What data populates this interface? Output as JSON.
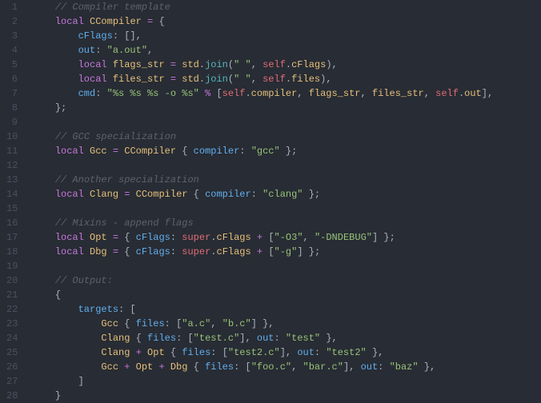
{
  "lines": [
    {
      "num": 1,
      "tokens": [
        [
          "sp",
          "    "
        ],
        [
          "comment",
          "// Compiler template"
        ]
      ]
    },
    {
      "num": 2,
      "tokens": [
        [
          "sp",
          "    "
        ],
        [
          "keyword",
          "local"
        ],
        [
          "sp",
          " "
        ],
        [
          "ident",
          "CCompiler"
        ],
        [
          "sp",
          " "
        ],
        [
          "op",
          "="
        ],
        [
          "sp",
          " "
        ],
        [
          "punc",
          "{"
        ]
      ]
    },
    {
      "num": 3,
      "tokens": [
        [
          "sp",
          "        "
        ],
        [
          "prop",
          "cFlags"
        ],
        [
          "punc",
          ":"
        ],
        [
          "sp",
          " "
        ],
        [
          "punc",
          "[],"
        ]
      ]
    },
    {
      "num": 4,
      "tokens": [
        [
          "sp",
          "        "
        ],
        [
          "prop",
          "out"
        ],
        [
          "punc",
          ":"
        ],
        [
          "sp",
          " "
        ],
        [
          "string",
          "\"a.out\""
        ],
        [
          "punc",
          ","
        ]
      ]
    },
    {
      "num": 5,
      "tokens": [
        [
          "sp",
          "        "
        ],
        [
          "keyword",
          "local"
        ],
        [
          "sp",
          " "
        ],
        [
          "ident",
          "flags_str"
        ],
        [
          "sp",
          " "
        ],
        [
          "op",
          "="
        ],
        [
          "sp",
          " "
        ],
        [
          "ident",
          "std"
        ],
        [
          "punc",
          "."
        ],
        [
          "func",
          "join"
        ],
        [
          "punc",
          "("
        ],
        [
          "string",
          "\" \""
        ],
        [
          "punc",
          ", "
        ],
        [
          "self",
          "self"
        ],
        [
          "punc",
          "."
        ],
        [
          "ident",
          "cFlags"
        ],
        [
          "punc",
          "),"
        ]
      ]
    },
    {
      "num": 6,
      "tokens": [
        [
          "sp",
          "        "
        ],
        [
          "keyword",
          "local"
        ],
        [
          "sp",
          " "
        ],
        [
          "ident",
          "files_str"
        ],
        [
          "sp",
          " "
        ],
        [
          "op",
          "="
        ],
        [
          "sp",
          " "
        ],
        [
          "ident",
          "std"
        ],
        [
          "punc",
          "."
        ],
        [
          "func",
          "join"
        ],
        [
          "punc",
          "("
        ],
        [
          "string",
          "\" \""
        ],
        [
          "punc",
          ", "
        ],
        [
          "self",
          "self"
        ],
        [
          "punc",
          "."
        ],
        [
          "ident",
          "files"
        ],
        [
          "punc",
          "),"
        ]
      ]
    },
    {
      "num": 7,
      "tokens": [
        [
          "sp",
          "        "
        ],
        [
          "prop",
          "cmd"
        ],
        [
          "punc",
          ":"
        ],
        [
          "sp",
          " "
        ],
        [
          "string",
          "\"%s %s %s -o %s\""
        ],
        [
          "sp",
          " "
        ],
        [
          "op",
          "%"
        ],
        [
          "sp",
          " "
        ],
        [
          "punc",
          "["
        ],
        [
          "self",
          "self"
        ],
        [
          "punc",
          "."
        ],
        [
          "ident",
          "compiler"
        ],
        [
          "punc",
          ", "
        ],
        [
          "ident",
          "flags_str"
        ],
        [
          "punc",
          ", "
        ],
        [
          "ident",
          "files_str"
        ],
        [
          "punc",
          ", "
        ],
        [
          "self",
          "self"
        ],
        [
          "punc",
          "."
        ],
        [
          "ident",
          "out"
        ],
        [
          "punc",
          "],"
        ]
      ]
    },
    {
      "num": 8,
      "tokens": [
        [
          "sp",
          "    "
        ],
        [
          "punc",
          "};"
        ]
      ]
    },
    {
      "num": 9,
      "tokens": [
        [
          "sp",
          ""
        ]
      ]
    },
    {
      "num": 10,
      "tokens": [
        [
          "sp",
          "    "
        ],
        [
          "comment",
          "// GCC specialization"
        ]
      ]
    },
    {
      "num": 11,
      "tokens": [
        [
          "sp",
          "    "
        ],
        [
          "keyword",
          "local"
        ],
        [
          "sp",
          " "
        ],
        [
          "ident",
          "Gcc"
        ],
        [
          "sp",
          " "
        ],
        [
          "op",
          "="
        ],
        [
          "sp",
          " "
        ],
        [
          "ident",
          "CCompiler"
        ],
        [
          "sp",
          " "
        ],
        [
          "punc",
          "{"
        ],
        [
          "sp",
          " "
        ],
        [
          "prop",
          "compiler"
        ],
        [
          "punc",
          ":"
        ],
        [
          "sp",
          " "
        ],
        [
          "string",
          "\"gcc\""
        ],
        [
          "sp",
          " "
        ],
        [
          "punc",
          "};"
        ]
      ]
    },
    {
      "num": 12,
      "tokens": [
        [
          "sp",
          ""
        ]
      ]
    },
    {
      "num": 13,
      "tokens": [
        [
          "sp",
          "    "
        ],
        [
          "comment",
          "// Another specialization"
        ]
      ]
    },
    {
      "num": 14,
      "tokens": [
        [
          "sp",
          "    "
        ],
        [
          "keyword",
          "local"
        ],
        [
          "sp",
          " "
        ],
        [
          "ident",
          "Clang"
        ],
        [
          "sp",
          " "
        ],
        [
          "op",
          "="
        ],
        [
          "sp",
          " "
        ],
        [
          "ident",
          "CCompiler"
        ],
        [
          "sp",
          " "
        ],
        [
          "punc",
          "{"
        ],
        [
          "sp",
          " "
        ],
        [
          "prop",
          "compiler"
        ],
        [
          "punc",
          ":"
        ],
        [
          "sp",
          " "
        ],
        [
          "string",
          "\"clang\""
        ],
        [
          "sp",
          " "
        ],
        [
          "punc",
          "};"
        ]
      ]
    },
    {
      "num": 15,
      "tokens": [
        [
          "sp",
          ""
        ]
      ]
    },
    {
      "num": 16,
      "tokens": [
        [
          "sp",
          "    "
        ],
        [
          "comment",
          "// Mixins - append flags"
        ]
      ]
    },
    {
      "num": 17,
      "tokens": [
        [
          "sp",
          "    "
        ],
        [
          "keyword",
          "local"
        ],
        [
          "sp",
          " "
        ],
        [
          "ident",
          "Opt"
        ],
        [
          "sp",
          " "
        ],
        [
          "op",
          "="
        ],
        [
          "sp",
          " "
        ],
        [
          "punc",
          "{"
        ],
        [
          "sp",
          " "
        ],
        [
          "prop",
          "cFlags"
        ],
        [
          "punc",
          ":"
        ],
        [
          "sp",
          " "
        ],
        [
          "self",
          "super"
        ],
        [
          "punc",
          "."
        ],
        [
          "ident",
          "cFlags"
        ],
        [
          "sp",
          " "
        ],
        [
          "op",
          "+"
        ],
        [
          "sp",
          " "
        ],
        [
          "punc",
          "["
        ],
        [
          "string",
          "\"-O3\""
        ],
        [
          "punc",
          ", "
        ],
        [
          "string",
          "\"-DNDEBUG\""
        ],
        [
          "punc",
          "]"
        ],
        [
          "sp",
          " "
        ],
        [
          "punc",
          "};"
        ]
      ]
    },
    {
      "num": 18,
      "tokens": [
        [
          "sp",
          "    "
        ],
        [
          "keyword",
          "local"
        ],
        [
          "sp",
          " "
        ],
        [
          "ident",
          "Dbg"
        ],
        [
          "sp",
          " "
        ],
        [
          "op",
          "="
        ],
        [
          "sp",
          " "
        ],
        [
          "punc",
          "{"
        ],
        [
          "sp",
          " "
        ],
        [
          "prop",
          "cFlags"
        ],
        [
          "punc",
          ":"
        ],
        [
          "sp",
          " "
        ],
        [
          "self",
          "super"
        ],
        [
          "punc",
          "."
        ],
        [
          "ident",
          "cFlags"
        ],
        [
          "sp",
          " "
        ],
        [
          "op",
          "+"
        ],
        [
          "sp",
          " "
        ],
        [
          "punc",
          "["
        ],
        [
          "string",
          "\"-g\""
        ],
        [
          "punc",
          "]"
        ],
        [
          "sp",
          " "
        ],
        [
          "punc",
          "};"
        ]
      ]
    },
    {
      "num": 19,
      "tokens": [
        [
          "sp",
          ""
        ]
      ]
    },
    {
      "num": 20,
      "tokens": [
        [
          "sp",
          "    "
        ],
        [
          "comment",
          "// Output:"
        ]
      ]
    },
    {
      "num": 21,
      "tokens": [
        [
          "sp",
          "    "
        ],
        [
          "punc",
          "{"
        ]
      ]
    },
    {
      "num": 22,
      "tokens": [
        [
          "sp",
          "        "
        ],
        [
          "prop",
          "targets"
        ],
        [
          "punc",
          ":"
        ],
        [
          "sp",
          " "
        ],
        [
          "punc",
          "["
        ]
      ]
    },
    {
      "num": 23,
      "tokens": [
        [
          "sp",
          "            "
        ],
        [
          "ident",
          "Gcc"
        ],
        [
          "sp",
          " "
        ],
        [
          "punc",
          "{"
        ],
        [
          "sp",
          " "
        ],
        [
          "prop",
          "files"
        ],
        [
          "punc",
          ":"
        ],
        [
          "sp",
          " "
        ],
        [
          "punc",
          "["
        ],
        [
          "string",
          "\"a.c\""
        ],
        [
          "punc",
          ", "
        ],
        [
          "string",
          "\"b.c\""
        ],
        [
          "punc",
          "]"
        ],
        [
          "sp",
          " "
        ],
        [
          "punc",
          "},"
        ]
      ]
    },
    {
      "num": 24,
      "tokens": [
        [
          "sp",
          "            "
        ],
        [
          "ident",
          "Clang"
        ],
        [
          "sp",
          " "
        ],
        [
          "punc",
          "{"
        ],
        [
          "sp",
          " "
        ],
        [
          "prop",
          "files"
        ],
        [
          "punc",
          ":"
        ],
        [
          "sp",
          " "
        ],
        [
          "punc",
          "["
        ],
        [
          "string",
          "\"test.c\""
        ],
        [
          "punc",
          "]"
        ],
        [
          "punc",
          ", "
        ],
        [
          "prop",
          "out"
        ],
        [
          "punc",
          ":"
        ],
        [
          "sp",
          " "
        ],
        [
          "string",
          "\"test\""
        ],
        [
          "sp",
          " "
        ],
        [
          "punc",
          "},"
        ]
      ]
    },
    {
      "num": 25,
      "tokens": [
        [
          "sp",
          "            "
        ],
        [
          "ident",
          "Clang"
        ],
        [
          "sp",
          " "
        ],
        [
          "op",
          "+"
        ],
        [
          "sp",
          " "
        ],
        [
          "ident",
          "Opt"
        ],
        [
          "sp",
          " "
        ],
        [
          "punc",
          "{"
        ],
        [
          "sp",
          " "
        ],
        [
          "prop",
          "files"
        ],
        [
          "punc",
          ":"
        ],
        [
          "sp",
          " "
        ],
        [
          "punc",
          "["
        ],
        [
          "string",
          "\"test2.c\""
        ],
        [
          "punc",
          "]"
        ],
        [
          "punc",
          ", "
        ],
        [
          "prop",
          "out"
        ],
        [
          "punc",
          ":"
        ],
        [
          "sp",
          " "
        ],
        [
          "string",
          "\"test2\""
        ],
        [
          "sp",
          " "
        ],
        [
          "punc",
          "},"
        ]
      ]
    },
    {
      "num": 26,
      "tokens": [
        [
          "sp",
          "            "
        ],
        [
          "ident",
          "Gcc"
        ],
        [
          "sp",
          " "
        ],
        [
          "op",
          "+"
        ],
        [
          "sp",
          " "
        ],
        [
          "ident",
          "Opt"
        ],
        [
          "sp",
          " "
        ],
        [
          "op",
          "+"
        ],
        [
          "sp",
          " "
        ],
        [
          "ident",
          "Dbg"
        ],
        [
          "sp",
          " "
        ],
        [
          "punc",
          "{"
        ],
        [
          "sp",
          " "
        ],
        [
          "prop",
          "files"
        ],
        [
          "punc",
          ":"
        ],
        [
          "sp",
          " "
        ],
        [
          "punc",
          "["
        ],
        [
          "string",
          "\"foo.c\""
        ],
        [
          "punc",
          ", "
        ],
        [
          "string",
          "\"bar.c\""
        ],
        [
          "punc",
          "]"
        ],
        [
          "punc",
          ", "
        ],
        [
          "prop",
          "out"
        ],
        [
          "punc",
          ":"
        ],
        [
          "sp",
          " "
        ],
        [
          "string",
          "\"baz\""
        ],
        [
          "sp",
          " "
        ],
        [
          "punc",
          "},"
        ]
      ]
    },
    {
      "num": 27,
      "tokens": [
        [
          "sp",
          "        "
        ],
        [
          "punc",
          "]"
        ]
      ]
    },
    {
      "num": 28,
      "tokens": [
        [
          "sp",
          "    "
        ],
        [
          "punc",
          "}"
        ]
      ]
    }
  ],
  "token_classes": {
    "comment": "c-comment",
    "keyword": "c-keyword",
    "ident": "c-ident",
    "prop": "c-prop",
    "string": "c-string",
    "self": "c-self",
    "func": "c-func",
    "punc": "c-punc",
    "op": "c-op",
    "sp": ""
  }
}
